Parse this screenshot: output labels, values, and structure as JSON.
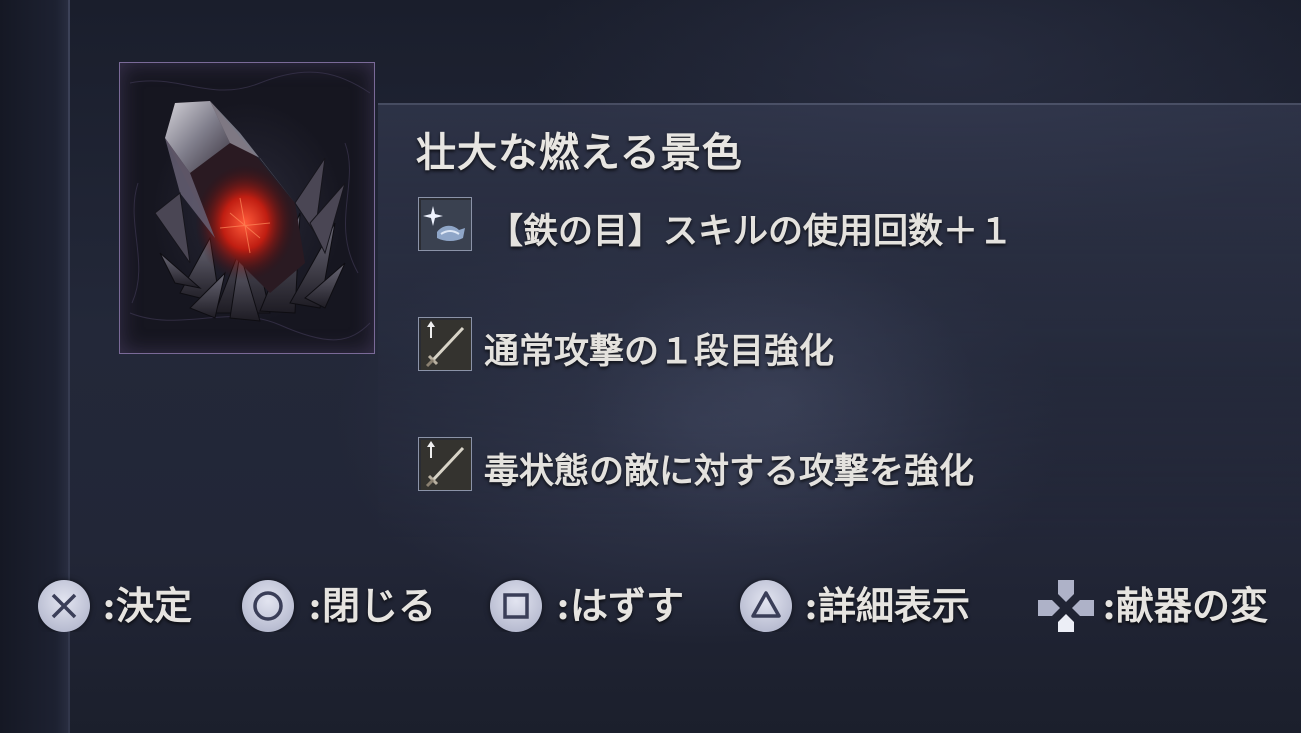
{
  "item": {
    "name": "壮大な燃える景色",
    "icon": "burning-crystal-icon",
    "frame_color": "#7a6a98"
  },
  "effects": [
    {
      "icon": "iron-eye-skill-icon",
      "text": "【鉄の目】スキルの使用回数＋１"
    },
    {
      "icon": "sword-up-icon",
      "text": "通常攻撃の１段目強化"
    },
    {
      "icon": "sword-up-icon",
      "text": "毒状態の敵に対する攻撃を強化"
    }
  ],
  "controls": [
    {
      "button": "cross-button-icon",
      "label": ":決定"
    },
    {
      "button": "circle-button-icon",
      "label": ":閉じる"
    },
    {
      "button": "square-button-icon",
      "label": ":はずす"
    },
    {
      "button": "triangle-button-icon",
      "label": ":詳細表示"
    },
    {
      "button": "dpad-icon",
      "label": ":献器の変"
    }
  ],
  "colors": {
    "text": "#e6e4e0",
    "crystal_glow": "#e0301c",
    "button_fill": "#c9cce0"
  }
}
